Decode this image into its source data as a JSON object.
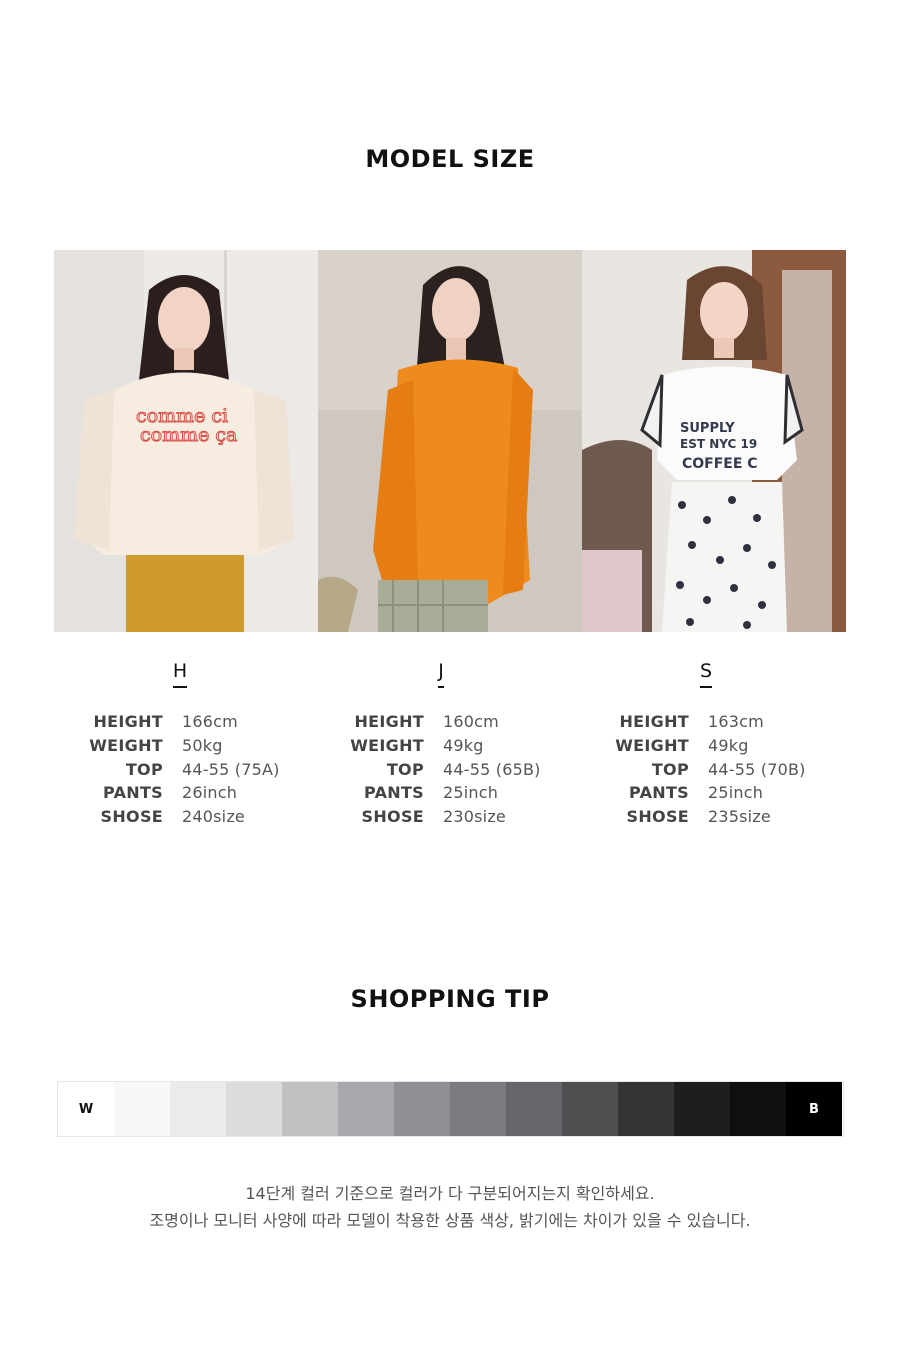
{
  "model_size": {
    "title": "MODEL SIZE",
    "models": [
      {
        "name": "H",
        "stats": [
          {
            "label": "HEIGHT",
            "value": "166cm"
          },
          {
            "label": "WEIGHT",
            "value": "50kg"
          },
          {
            "label": "TOP",
            "value": "44-55 (75A)"
          },
          {
            "label": "PANTS",
            "value": "26inch"
          },
          {
            "label": "SHOSE",
            "value": "240size"
          }
        ]
      },
      {
        "name": "J",
        "stats": [
          {
            "label": "HEIGHT",
            "value": "160cm"
          },
          {
            "label": "WEIGHT",
            "value": "49kg"
          },
          {
            "label": "TOP",
            "value": "44-55 (65B)"
          },
          {
            "label": "PANTS",
            "value": "25inch"
          },
          {
            "label": "SHOSE",
            "value": "230size"
          }
        ]
      },
      {
        "name": "S",
        "stats": [
          {
            "label": "HEIGHT",
            "value": "163cm"
          },
          {
            "label": "WEIGHT",
            "value": "49kg"
          },
          {
            "label": "TOP",
            "value": "44-55 (70B)"
          },
          {
            "label": "PANTS",
            "value": "25inch"
          },
          {
            "label": "SHOSE",
            "value": "235size"
          }
        ]
      }
    ],
    "photo_prints": {
      "h": [
        "comme ci",
        "comme ça"
      ],
      "s": [
        "SUPPLY",
        "EST NYC 19",
        "COFFEE C"
      ]
    }
  },
  "shopping_tip": {
    "title": "SHOPPING TIP",
    "scale_start_label": "W",
    "scale_end_label": "B",
    "scale_colors": [
      "#ffffff",
      "#f8f8f8",
      "#ecebec",
      "#dcdcdc",
      "#c0c1c3",
      "#a7a8ab",
      "#8f9094",
      "#7b7c80",
      "#66676b",
      "#4e4f51",
      "#343436",
      "#1e1e1e",
      "#0f0f0e",
      "#000000"
    ],
    "lines": [
      "14단계 컬러 기준으로 컬러가 다 구분되어지는지 확인하세요.",
      "조명이나 모니터 사양에 따라 모델이 착용한 상품 색상, 밝기에는 차이가 있을 수 있습니다."
    ]
  }
}
